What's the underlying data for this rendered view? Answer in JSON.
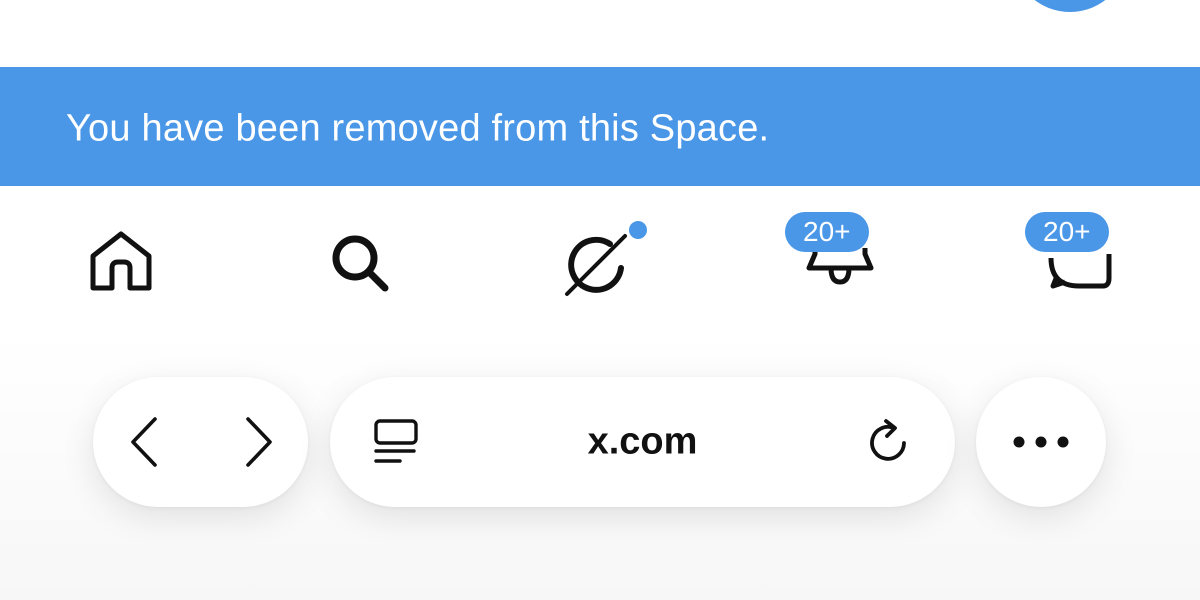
{
  "toast": {
    "message": "You have been removed from this Space."
  },
  "tab_bar": {
    "items": [
      {
        "name": "home",
        "icon": "home-icon"
      },
      {
        "name": "search",
        "icon": "search-icon"
      },
      {
        "name": "grok",
        "icon": "grok-icon",
        "has_dot": true
      },
      {
        "name": "notifications",
        "icon": "bell-icon",
        "badge": "20+"
      },
      {
        "name": "messages",
        "icon": "message-icon",
        "badge": "20+"
      }
    ]
  },
  "browser": {
    "url": "x.com",
    "back_icon": "chevron-left-icon",
    "forward_icon": "chevron-right-icon",
    "page_menu_icon": "page-menu-icon",
    "reload_icon": "reload-icon",
    "more_icon": "more-icon"
  },
  "colors": {
    "accent": "#4a97e8",
    "text": "#111111",
    "background": "#ffffff"
  }
}
